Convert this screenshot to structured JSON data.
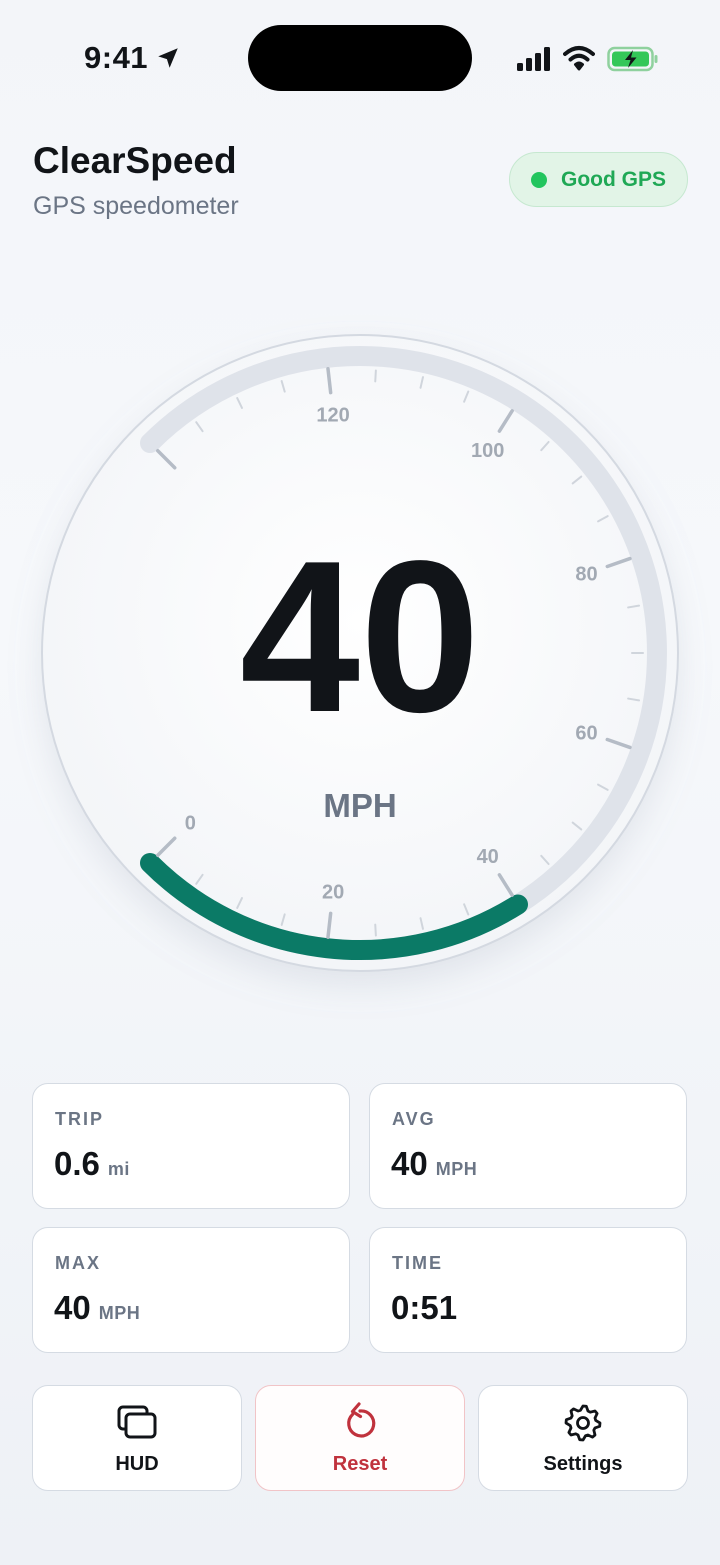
{
  "status_bar": {
    "time": "9:41",
    "icons": [
      "location-arrow-icon",
      "cellular-signal-icon",
      "wifi-icon",
      "battery-charging-icon"
    ]
  },
  "header": {
    "title": "ClearSpeed",
    "subtitle": "GPS speedometer",
    "gps_status": "Good GPS",
    "gps_status_color": "#22c55e"
  },
  "gauge": {
    "speed": "40",
    "unit": "MPH",
    "speed_value": 40,
    "min": 0,
    "max": 140,
    "tick_labels": [
      "0",
      "20",
      "40",
      "60",
      "80",
      "100",
      "120"
    ],
    "accent_color": "#0b7a66",
    "track_color": "#dfe3ea"
  },
  "stats": {
    "trip": {
      "label": "TRIP",
      "value": "0.6",
      "unit": "mi"
    },
    "avg": {
      "label": "AVG",
      "value": "40",
      "unit": "MPH"
    },
    "max": {
      "label": "MAX",
      "value": "40",
      "unit": "MPH"
    },
    "time": {
      "label": "TIME",
      "value": "0:51"
    }
  },
  "actions": {
    "hud": {
      "label": "HUD",
      "icon": "hud-windows-icon"
    },
    "reset": {
      "label": "Reset",
      "icon": "reset-arrow-icon",
      "color": "#c0323d"
    },
    "settings": {
      "label": "Settings",
      "icon": "gear-icon"
    }
  }
}
